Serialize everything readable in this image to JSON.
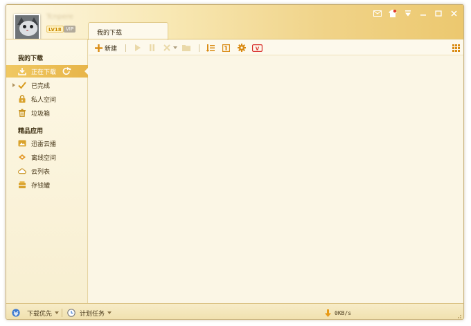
{
  "user": {
    "name": "Tcnpere",
    "level": "LV18",
    "vip": "VIP"
  },
  "tabs": [
    {
      "label": "我的下载"
    }
  ],
  "sidebar": {
    "my_downloads_title": "我的下载",
    "items": [
      {
        "label": "正在下载",
        "icon": "download-icon",
        "active": true
      },
      {
        "label": "已完成",
        "icon": "check-icon"
      },
      {
        "label": "私人空间",
        "icon": "lock-icon"
      },
      {
        "label": "垃圾箱",
        "icon": "trash-icon"
      }
    ],
    "apps_title": "精品应用",
    "apps": [
      {
        "label": "迅雷云播",
        "icon": "cloud-play-icon"
      },
      {
        "label": "离线空间",
        "icon": "offline-icon"
      },
      {
        "label": "云列表",
        "icon": "cloud-list-icon"
      },
      {
        "label": "存钱罐",
        "icon": "piggy-bank-icon"
      }
    ]
  },
  "toolbar": {
    "new_label": "新建"
  },
  "statusbar": {
    "download_priority": "下载优先",
    "scheduled_task": "计划任务",
    "speed": "0KB/s"
  },
  "colors": {
    "accent": "#e7b54a",
    "header_gold": "#ecc86f",
    "vip_red": "#d9302c",
    "blue": "#3d7ad0"
  }
}
